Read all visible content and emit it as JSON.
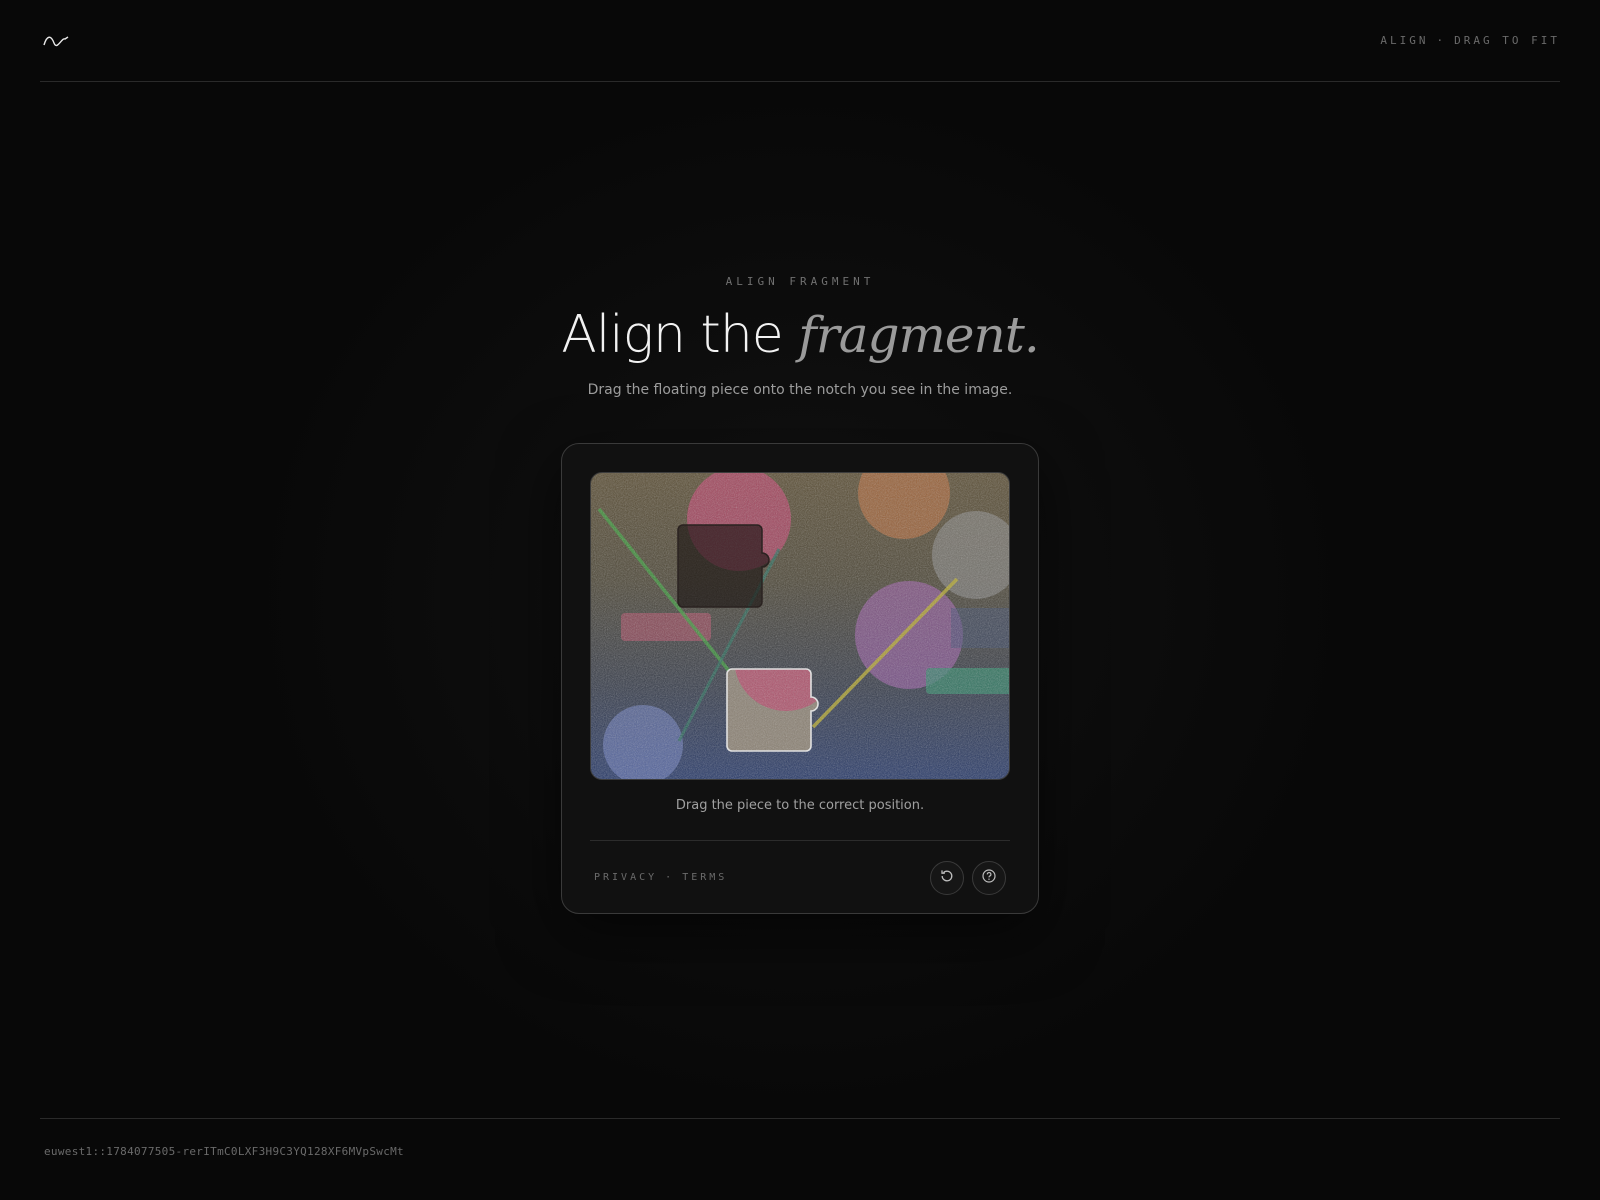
{
  "header": {
    "logo_icon": "wave-logo-icon",
    "nav_left": "ALIGN",
    "nav_separator": "·",
    "nav_right": "DRAG TO FIT"
  },
  "intro": {
    "eyebrow": "ALIGN FRAGMENT",
    "title_plain": "Align the",
    "title_emphasis": "fragment.",
    "subtitle": "Drag the floating piece onto the notch you see in the image."
  },
  "puzzle": {
    "hint": "Drag the piece to the correct position."
  },
  "card_footer": {
    "privacy": "PRIVACY",
    "separator": "·",
    "terms": "TERMS",
    "refresh_icon": "refresh-icon",
    "help_icon": "help-icon"
  },
  "footer": {
    "session_id": "euwest1::1784077505-rerITmC0LXF3H9C3YQ128XF6MVpSwcMt"
  },
  "colors": {
    "background": "#0a0a0a",
    "card": "#111111",
    "text_primary": "#f2f2f2",
    "text_muted": "#9c9c9c"
  }
}
